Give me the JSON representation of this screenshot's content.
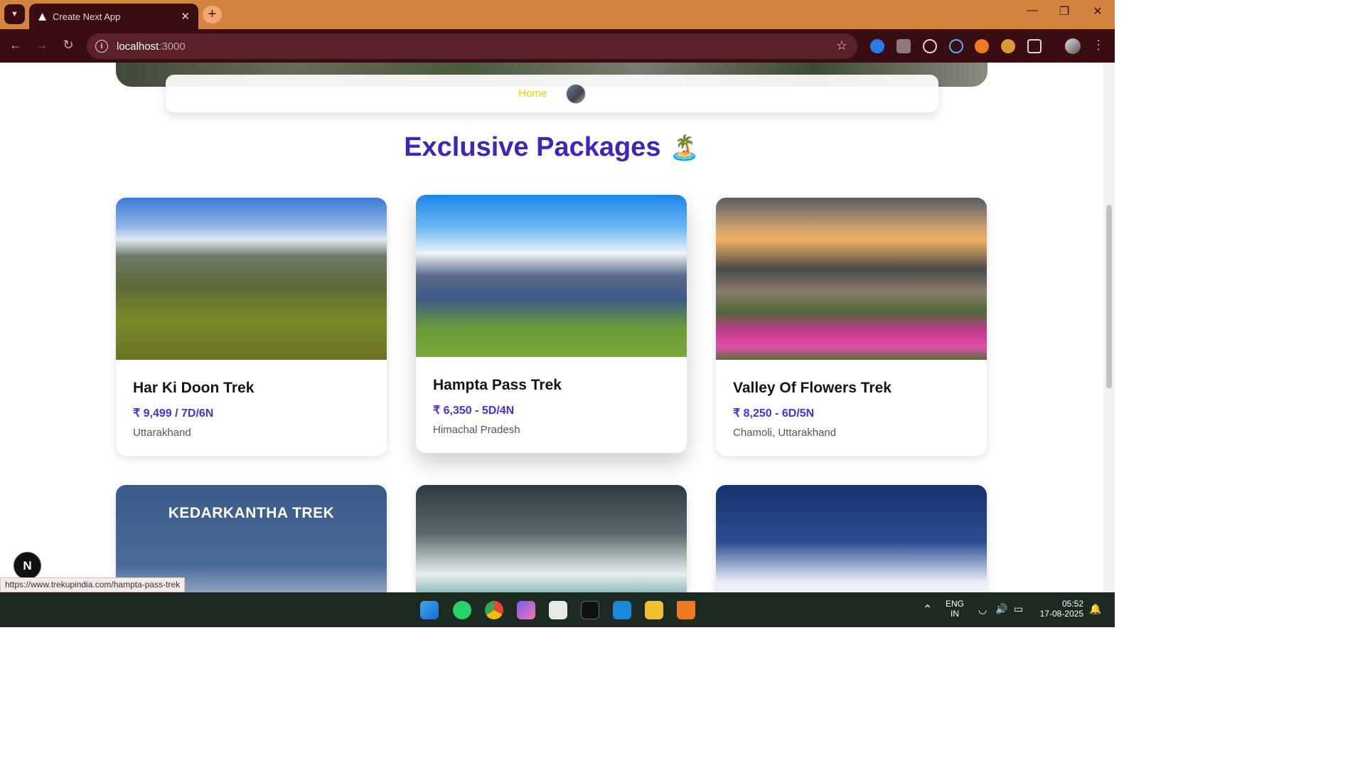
{
  "browser": {
    "tab_title": "Create Next App",
    "tab_close": "✕",
    "new_tab": "+",
    "url_host": "localhost",
    "url_port": ":3000",
    "status_url": "https://www.trekupindia.com/hampta-pass-trek"
  },
  "site": {
    "nav_home": "Home",
    "heading": "Exclusive Packages",
    "heading_emoji": "🏝️"
  },
  "packages": [
    {
      "name": "Har Ki Doon Trek",
      "price": "₹ 9,499 / 7D/6N",
      "location": "Uttarakhand"
    },
    {
      "name": "Hampta Pass Trek",
      "price": "₹ 6,350 - 5D/4N",
      "location": "Himachal Pradesh"
    },
    {
      "name": "Valley Of Flowers Trek",
      "price": "₹ 8,250 - 6D/5N",
      "location": "Chamoli, Uttarakhand"
    }
  ],
  "second_row": {
    "kedarkantha_banner": "KEDARKANTHA TREK"
  },
  "next_badge": "N",
  "taskbar": {
    "lang_top": "ENG",
    "lang_bottom": "IN",
    "time": "05:52",
    "date": "17-08-2025"
  }
}
